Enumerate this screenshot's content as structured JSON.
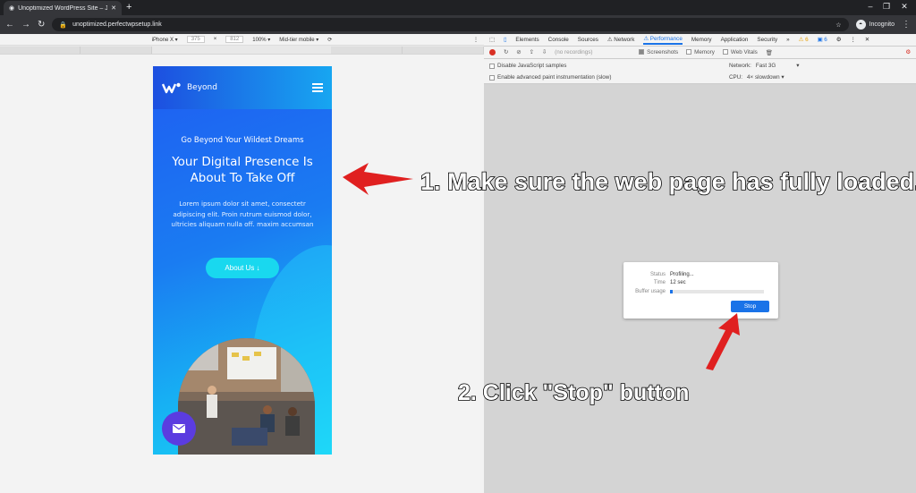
{
  "browser": {
    "tab_title": "Unoptimized WordPress Site – Ju",
    "new_tab": "+",
    "url": "unoptimized.perfectwpsetup.link",
    "profile": "Incognito",
    "window_controls": [
      "–",
      "❐",
      "✕"
    ]
  },
  "device_toolbar": {
    "device": "iPhone X ▾",
    "width": "375",
    "times": "×",
    "height": "812",
    "zoom": "100% ▾",
    "throttle": "Mid-tier mobile ▾"
  },
  "site": {
    "brand": "Beyond",
    "tagline": "Go Beyond Your Wildest Dreams",
    "headline": "Your Digital Presence Is About To Take Off",
    "body": "Lorem ipsum dolor sit amet, consectetr adipiscing elit. Proin rutrum euismod dolor, ultricies aliquam nulla off. maxim accumsan",
    "cta_label": "About Us ↓",
    "colors": {
      "header_start": "#1d4fe0",
      "header_end": "#17a6f1",
      "cta": "#19d8ef",
      "mail_fab": "#5b3ce0"
    }
  },
  "devtools": {
    "tabs": [
      "Elements",
      "Console",
      "Sources",
      "⚠ Network",
      "⚠ Performance",
      "Memory",
      "Application",
      "Security",
      "»"
    ],
    "active_tab": "⚠ Performance",
    "warnings": "⚠ 6",
    "messages": "▣ 6",
    "recording_select": "(no recordings)",
    "screenshots_label": "Screenshots",
    "memory_label": "Memory",
    "web_vitals_label": "Web Vitals",
    "disable_js_label": "Disable JavaScript samples",
    "advanced_paint_label": "Enable advanced paint instrumentation (slow)",
    "network_label": "Network:",
    "network_value": "Fast 3G",
    "cpu_label": "CPU:",
    "cpu_value": "4× slowdown ▾",
    "accent": "#1a73e8"
  },
  "profiling_dialog": {
    "status_label": "Status",
    "status_value": "Profiling...",
    "time_label": "Time",
    "time_value": "12 sec",
    "buffer_label": "Buffer usage",
    "buffer_fraction": 0.03,
    "stop_label": "Stop"
  },
  "annotations": {
    "step1": "1. Make sure the web page has fully loaded.",
    "step2": "2. Click \"Stop\" button",
    "arrow_color": "#e02020"
  }
}
